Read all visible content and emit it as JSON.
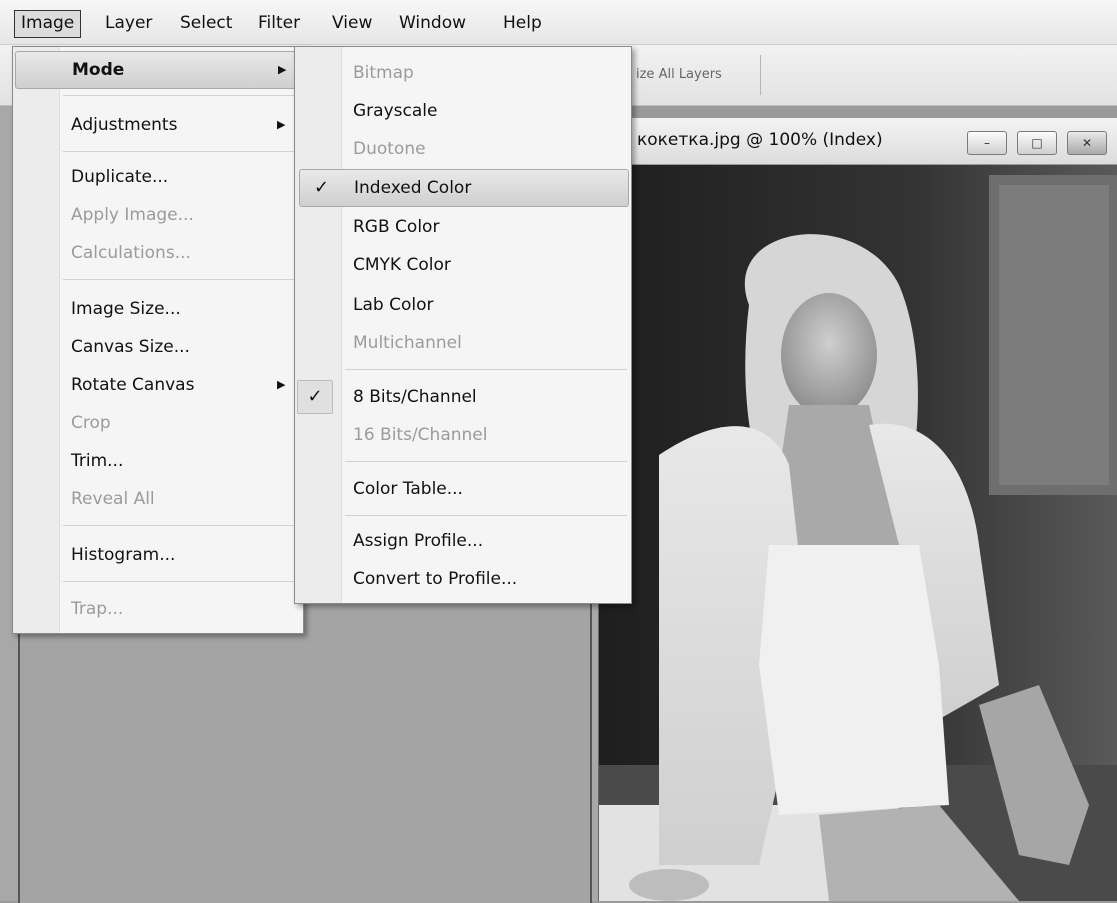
{
  "menubar": {
    "items": [
      "Image",
      "Layer",
      "Select",
      "Filter",
      "View",
      "Window",
      "Help"
    ]
  },
  "optionsbar": {
    "sample_all_layers": "ize All Layers"
  },
  "document": {
    "title": "кокетка.jpg @ 100% (Index)",
    "buttons": {
      "minimize": "–",
      "restore": "□",
      "close": "✕"
    }
  },
  "image_menu": {
    "items": [
      {
        "label": "Mode",
        "submenu": true,
        "highlighted": true
      },
      {
        "label": "Adjustments",
        "submenu": true
      },
      {
        "label": "Duplicate..."
      },
      {
        "label": "Apply Image...",
        "disabled": true
      },
      {
        "label": "Calculations...",
        "disabled": true
      },
      {
        "label": "Image Size..."
      },
      {
        "label": "Canvas Size..."
      },
      {
        "label": "Rotate Canvas",
        "submenu": true
      },
      {
        "label": "Crop",
        "disabled": true
      },
      {
        "label": "Trim..."
      },
      {
        "label": "Reveal All",
        "disabled": true
      },
      {
        "label": "Histogram..."
      },
      {
        "label": "Trap...",
        "disabled": true
      }
    ]
  },
  "mode_menu": {
    "items": [
      {
        "label": "Bitmap",
        "disabled": true
      },
      {
        "label": "Grayscale"
      },
      {
        "label": "Duotone",
        "disabled": true
      },
      {
        "label": "Indexed Color",
        "checked": true,
        "highlighted": true
      },
      {
        "label": "RGB Color"
      },
      {
        "label": "CMYK Color"
      },
      {
        "label": "Lab Color"
      },
      {
        "label": "Multichannel",
        "disabled": true
      },
      {
        "label": "8 Bits/Channel",
        "checked": true
      },
      {
        "label": "16 Bits/Channel",
        "disabled": true
      },
      {
        "label": "Color Table..."
      },
      {
        "label": "Assign Profile..."
      },
      {
        "label": "Convert to Profile..."
      }
    ]
  },
  "glyphs": {
    "check": "✓",
    "submenu_arrow": "▶"
  },
  "colors": {
    "menu_bg": "#f5f5f5",
    "disabled_text": "#9b9b9b",
    "workspace": "#a8a8a8"
  }
}
